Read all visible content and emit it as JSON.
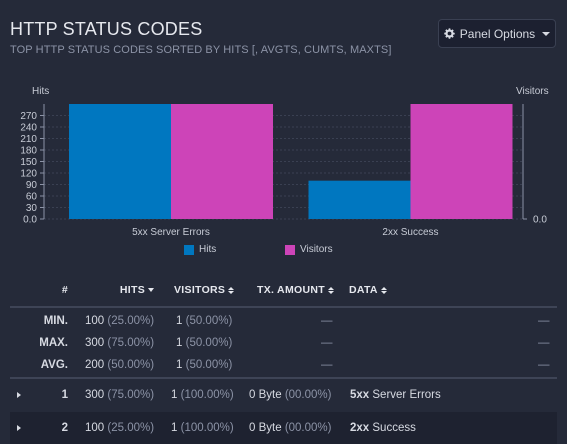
{
  "header": {
    "title": "HTTP STATUS CODES",
    "subtitle": "TOP HTTP STATUS CODES SORTED BY HITS [, AVGTS, CUMTS, MAXTS]",
    "panel_options_label": "Panel Options"
  },
  "chart_data": {
    "type": "bar",
    "categories": [
      "5xx Server Errors",
      "2xx Success"
    ],
    "series": [
      {
        "name": "Hits",
        "values": [
          300,
          100
        ],
        "color": "#0077c0"
      },
      {
        "name": "Visitors",
        "values": [
          1,
          1
        ],
        "color": "#cd44b8"
      }
    ],
    "ylabel_left": "Hits",
    "ylabel_right": "Visitors",
    "yticks_left": [
      "0.0",
      "30",
      "60",
      "90",
      "120",
      "150",
      "180",
      "210",
      "240",
      "270"
    ],
    "ylim_left": [
      0,
      300
    ],
    "yticks_right": [
      "0.0"
    ],
    "ylim_right": [
      0,
      1
    ],
    "grid": true,
    "legend_position": "bottom"
  },
  "table": {
    "columns": {
      "num": "#",
      "hits": "HITS",
      "visitors": "VISITORS",
      "tx": "TX. AMOUNT",
      "data": "DATA"
    },
    "dash": "—",
    "summary": [
      {
        "label": "MIN.",
        "hits": "100",
        "hits_pct": "(25.00%)",
        "visitors": "1",
        "visitors_pct": "(50.00%)"
      },
      {
        "label": "MAX.",
        "hits": "300",
        "hits_pct": "(75.00%)",
        "visitors": "1",
        "visitors_pct": "(50.00%)"
      },
      {
        "label": "AVG.",
        "hits": "200",
        "hits_pct": "(50.00%)",
        "visitors": "1",
        "visitors_pct": "(50.00%)"
      }
    ],
    "rows": [
      {
        "num": "1",
        "hits": "300",
        "hits_pct": "(75.00%)",
        "visitors": "1",
        "visitors_pct": "(100.00%)",
        "tx": "0 Byte",
        "tx_pct": "(00.00%)",
        "data_code": "5xx",
        "data_text": "Server Errors"
      },
      {
        "num": "2",
        "hits": "100",
        "hits_pct": "(25.00%)",
        "visitors": "1",
        "visitors_pct": "(100.00%)",
        "tx": "0 Byte",
        "tx_pct": "(00.00%)",
        "data_code": "2xx",
        "data_text": "Success"
      }
    ]
  }
}
